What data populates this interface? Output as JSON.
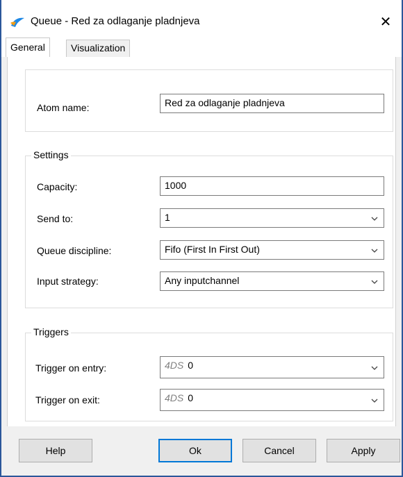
{
  "window": {
    "title": "Queue - Red za odlaganje pladnjeva",
    "close_icon": "close-icon",
    "app_icon": "app-icon"
  },
  "tabs": [
    {
      "label": "General",
      "active": true
    },
    {
      "label": "Visualization",
      "active": false
    }
  ],
  "atom": {
    "label": "Atom name:",
    "value": "Red za odlaganje pladnjeva"
  },
  "settings": {
    "title": "Settings",
    "capacity": {
      "label": "Capacity:",
      "value": "1000"
    },
    "send_to": {
      "label": "Send to:",
      "value": "1"
    },
    "queue_discipline": {
      "label": "Queue discipline:",
      "value": "Fifo (First In First Out)"
    },
    "input_strategy": {
      "label": "Input strategy:",
      "value": "Any inputchannel"
    }
  },
  "triggers": {
    "title": "Triggers",
    "on_entry": {
      "label": "Trigger on entry:",
      "prefix": "4DS",
      "value": "0"
    },
    "on_exit": {
      "label": "Trigger on exit:",
      "prefix": "4DS",
      "value": "0"
    }
  },
  "buttons": {
    "help": "Help",
    "ok": "Ok",
    "cancel": "Cancel",
    "apply": "Apply"
  },
  "colors": {
    "accent": "#0078d7",
    "window_border": "#2b579a"
  }
}
